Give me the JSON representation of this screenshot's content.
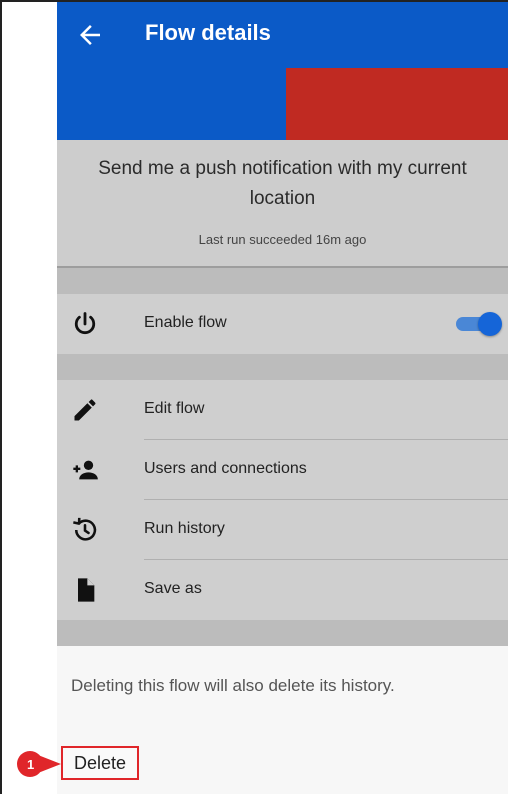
{
  "app": {
    "title": "Flow details"
  },
  "flow": {
    "name": "Send me a push notification with my current location",
    "last_run": "Last run succeeded 16m ago"
  },
  "menu": {
    "enable": {
      "label": "Enable flow",
      "enabled": true
    },
    "items": [
      {
        "label": "Edit flow",
        "icon": "pencil-icon"
      },
      {
        "label": "Users and connections",
        "icon": "add-user-icon"
      },
      {
        "label": "Run history",
        "icon": "history-icon"
      },
      {
        "label": "Save as",
        "icon": "document-icon"
      }
    ]
  },
  "delete": {
    "note": "Deleting this flow will also delete its history.",
    "label": "Delete"
  },
  "callout": {
    "number": "1",
    "color": "#e0262a"
  },
  "colors": {
    "appbar": "#0b5ac7",
    "banner_red": "#c02a22",
    "toggle": "#1565d8"
  }
}
